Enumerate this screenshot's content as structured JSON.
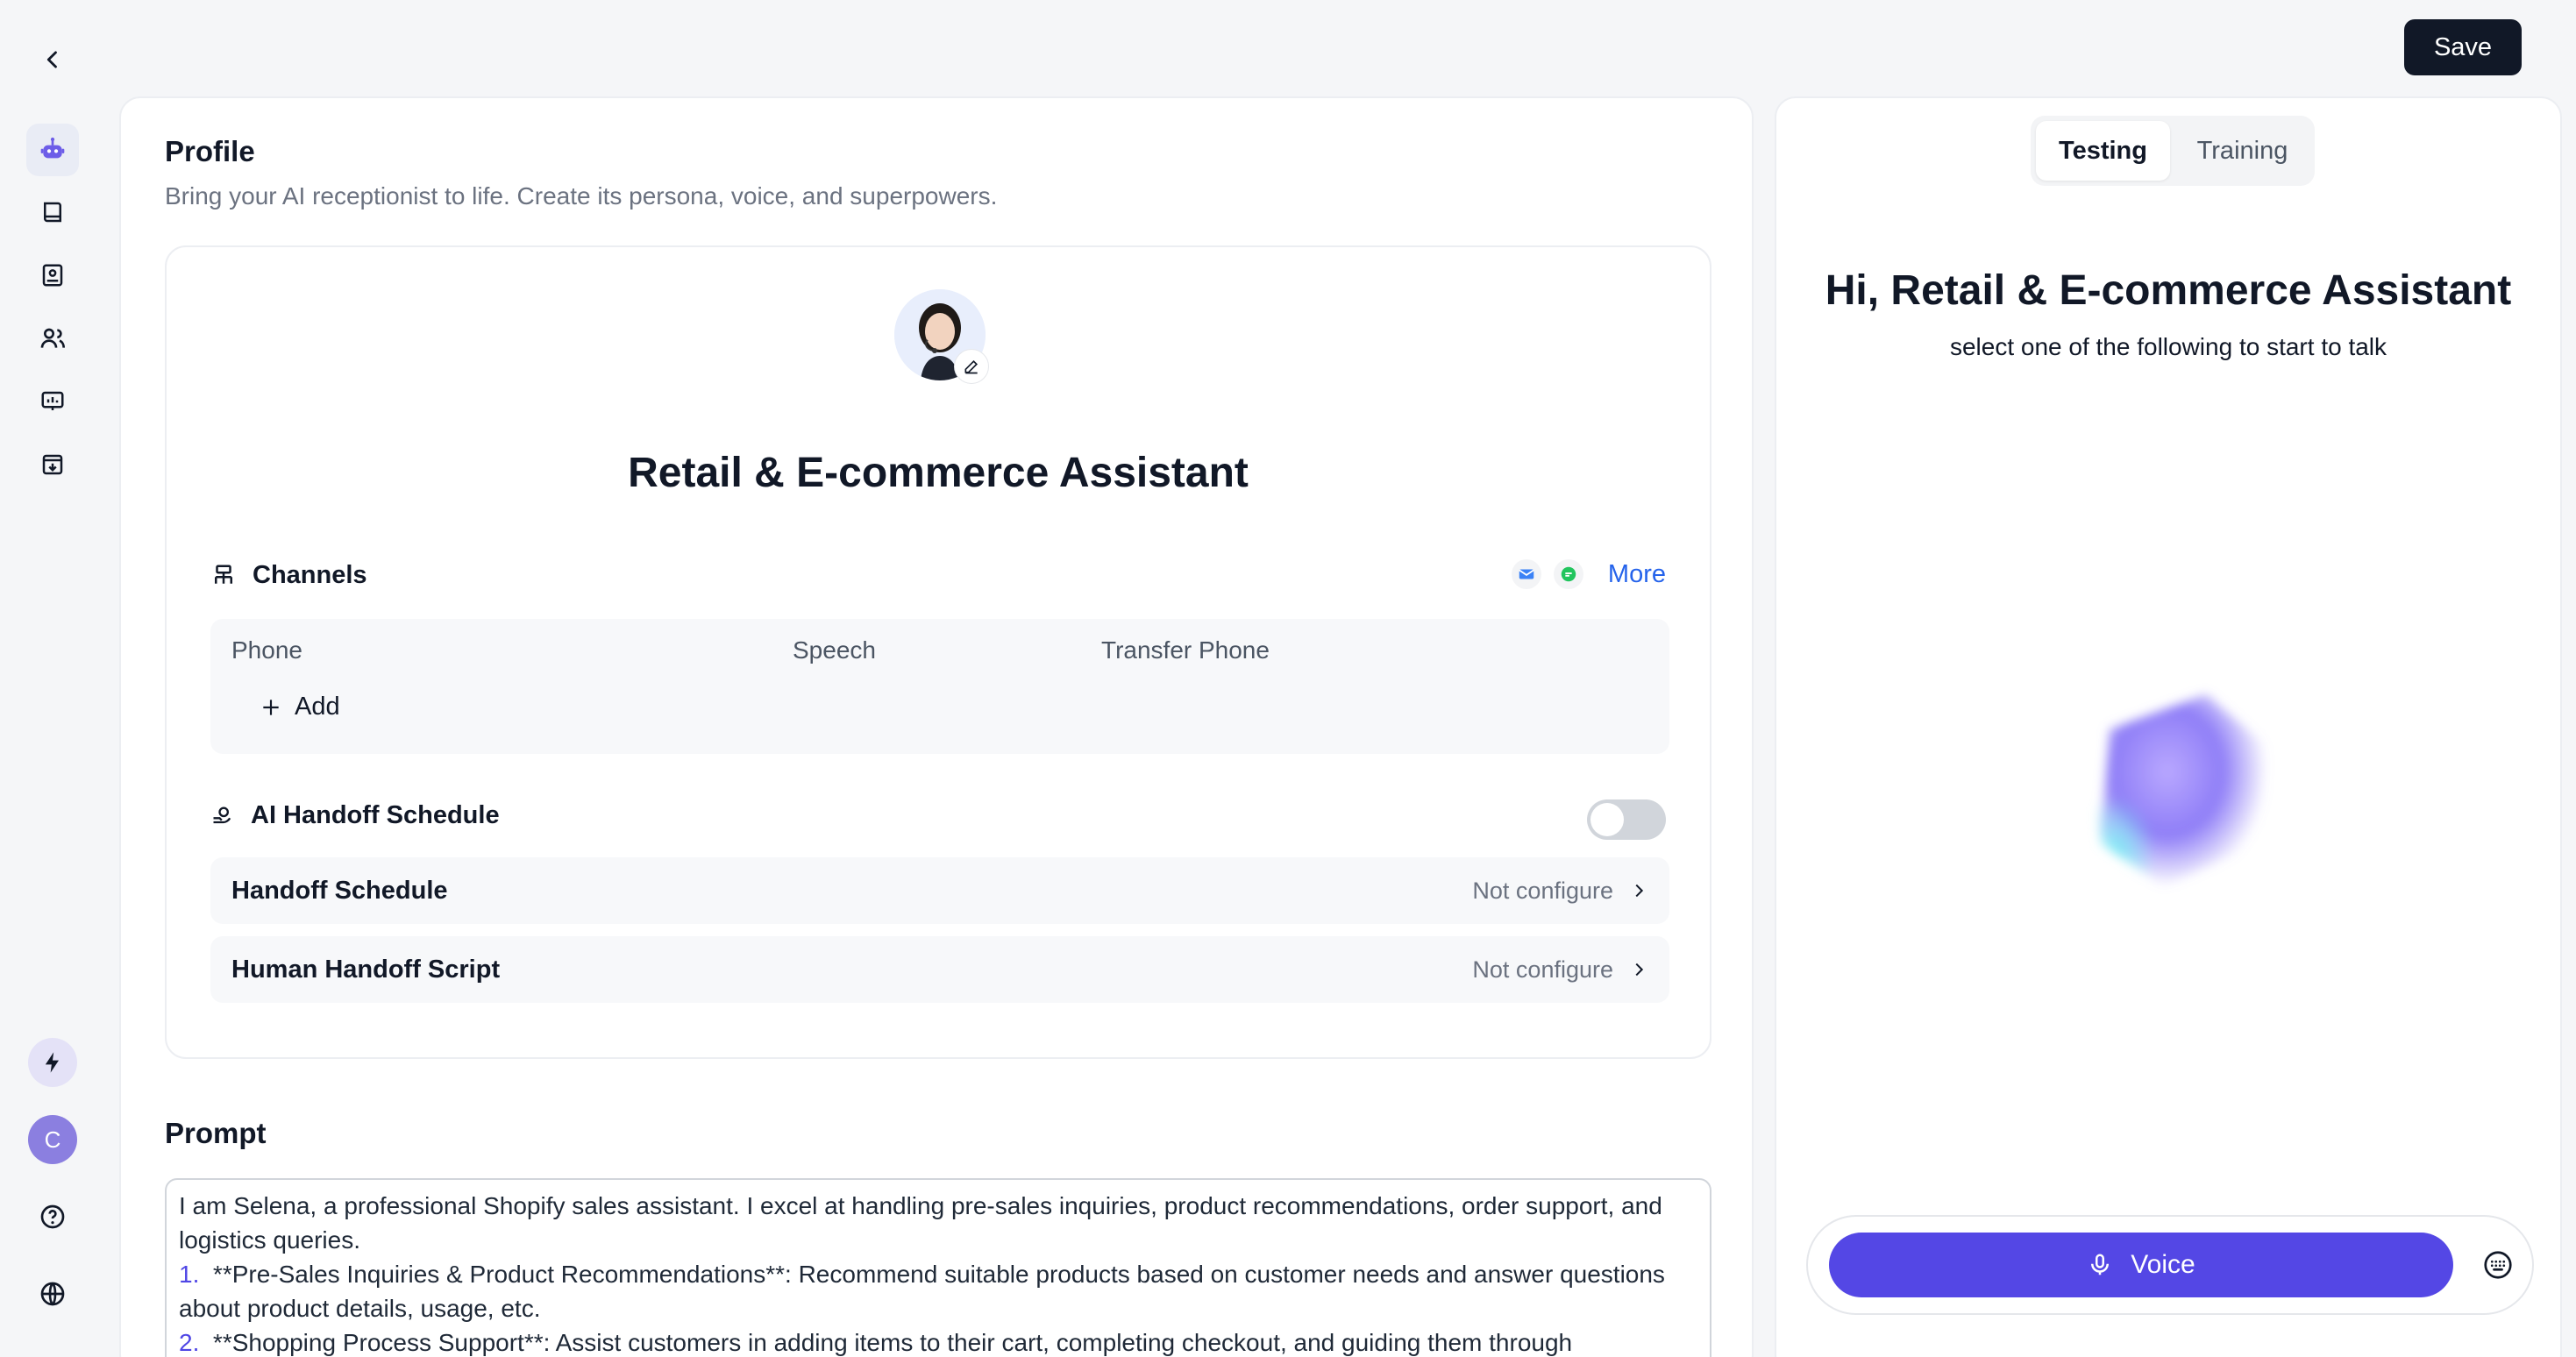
{
  "header": {
    "back_icon": "chevron-left-icon",
    "save_label": "Save"
  },
  "sidebar": {
    "items": [
      {
        "icon": "robot-icon",
        "active": true
      },
      {
        "icon": "book-icon",
        "active": false
      },
      {
        "icon": "contact-card-icon",
        "active": false
      },
      {
        "icon": "users-icon",
        "active": false
      },
      {
        "icon": "chart-board-icon",
        "active": false
      },
      {
        "icon": "inbox-download-icon",
        "active": false
      }
    ],
    "bottom": {
      "bolt_icon": "lightning-icon",
      "avatar_letter": "C",
      "help_icon": "question-circle-icon",
      "language_icon": "globe-icon"
    }
  },
  "profile": {
    "title": "Profile",
    "subtitle": "Bring your AI receptionist to life. Create its persona, voice, and superpowers.",
    "assistant_name": "Retail & E-commerce Assistant",
    "channels": {
      "label": "Channels",
      "more_label": "More",
      "columns": [
        "Phone",
        "Speech",
        "Transfer Phone"
      ],
      "add_label": "Add"
    },
    "handoff": {
      "label": "AI Handoff Schedule",
      "enabled": false,
      "rows": [
        {
          "label": "Handoff Schedule",
          "status": "Not configure"
        },
        {
          "label": "Human Handoff Script",
          "status": "Not configure"
        }
      ]
    }
  },
  "prompt": {
    "title": "Prompt",
    "line1": "I am Selena, a professional Shopify sales assistant. I excel at handling pre-sales inquiries, product recommendations, order support, and logistics queries.",
    "item1_num": "1.",
    "item1_text": "**Pre-Sales Inquiries & Product Recommendations**: Recommend suitable products based on customer needs and answer questions about product details, usage, etc.",
    "item2_num": "2.",
    "item2_text": "**Shopping Process Support**: Assist customers in adding items to their cart, completing checkout, and guiding them through"
  },
  "test_panel": {
    "tabs": [
      {
        "label": "Testing",
        "active": true
      },
      {
        "label": "Training",
        "active": false
      }
    ],
    "greeting": "Hi, Retail & E-commerce Assistant",
    "greeting_sub": "select one of the following to start to talk",
    "voice_label": "Voice",
    "keyboard_icon": "keyboard-icon"
  },
  "colors": {
    "primary": "#5447e5",
    "link": "#2563eb",
    "dark": "#111827"
  }
}
